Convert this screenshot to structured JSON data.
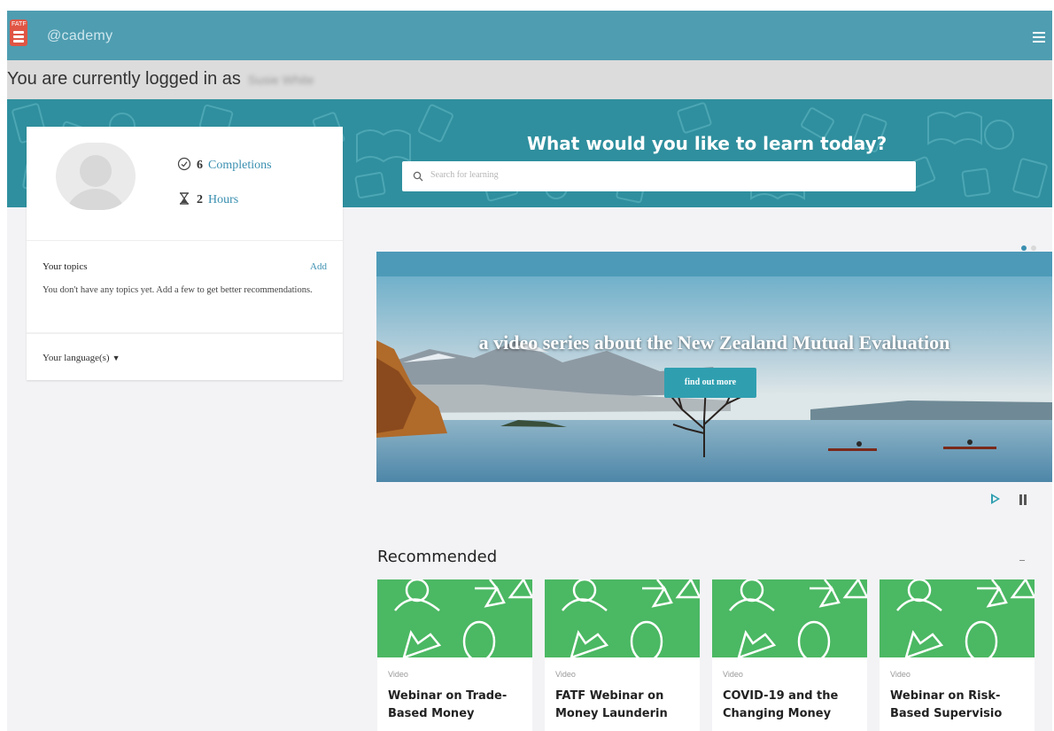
{
  "header": {
    "brand": "@cademy",
    "logo_text": "FATF"
  },
  "login": {
    "prefix": "You are currently logged in as",
    "user_name": "Susie White"
  },
  "hero": {
    "title": "What would you like to learn today?",
    "search_placeholder": "Search for learning"
  },
  "profile": {
    "completions_value": "6",
    "completions_label": "Completions",
    "hours_value": "2",
    "hours_label": "Hours",
    "topics_title": "Your topics",
    "topics_add": "Add",
    "topics_text": "You don't have any topics yet. Add a few to get better recommendations.",
    "language_label": "Your language(s)"
  },
  "carousel": {
    "slide_title": "a video series about the New Zealand Mutual Evaluation",
    "button_label": "find out more",
    "dots_active": 0,
    "dots_count": 2
  },
  "recommended": {
    "title": "Recommended",
    "cards": [
      {
        "type": "Video",
        "title": "Webinar on Trade-Based Money"
      },
      {
        "type": "Video",
        "title": "FATF Webinar on Money Launderin"
      },
      {
        "type": "Video",
        "title": "COVID-19 and the Changing Money"
      },
      {
        "type": "Video",
        "title": "Webinar on Risk-Based Supervisio"
      }
    ]
  },
  "colors": {
    "topbar": "#4f9db1",
    "hero": "#2f8f9e",
    "accent": "#2f9fb0",
    "card_thumb": "#4bb863",
    "link": "#3a8fb0"
  }
}
